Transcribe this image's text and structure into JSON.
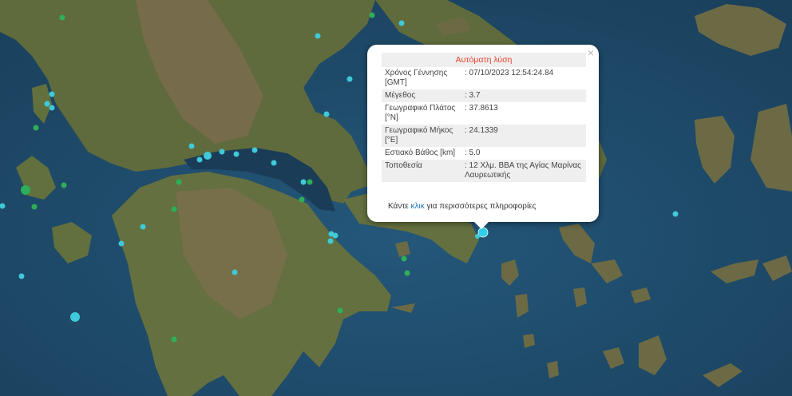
{
  "popup": {
    "title": "Αυτόματη λύση",
    "close_glyph": "×",
    "rows": [
      {
        "key": "Χρόνος Γέννησης [GMT]",
        "value": ": 07/10/2023 12:54:24.84"
      },
      {
        "key": "Μέγεθος",
        "value": ": 3.7"
      },
      {
        "key": "Γεωγραφικό Πλάτος [°N]",
        "value": ": 37.8613"
      },
      {
        "key": "Γεωγραφικό Μήκος [°E]",
        "value": ": 24.1339"
      },
      {
        "key": "Εστιακό Βάθος [km]",
        "value": ": 5.0"
      },
      {
        "key": "Τοποθεσία",
        "value": ": 12 Χλμ. ΒΒΑ της Αγίας Μαρίνας Λαυρεωτικής"
      }
    ],
    "more_prefix": "Κάντε ",
    "more_link": "κλικ",
    "more_suffix": " για περισσότερες πληροφορίες"
  },
  "colors": {
    "sea": "#1f4d6e",
    "land": "#5d6b3a",
    "mountain": "#7a6a4a",
    "quake_cyan": "#3fc9d9",
    "quake_green": "#2fae5a",
    "selected": "#2fd0e8"
  }
}
